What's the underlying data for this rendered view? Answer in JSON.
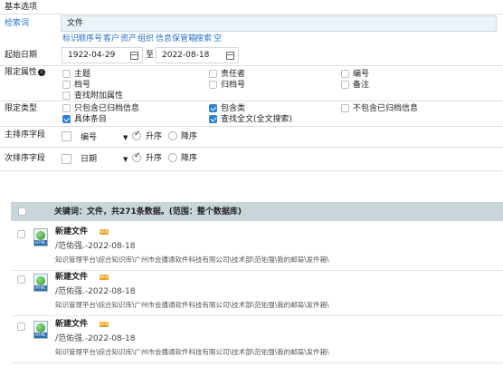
{
  "section_title": "基本选项",
  "keyword": {
    "label": "检索词",
    "value": "文件"
  },
  "quick_links": [
    "标识",
    "顺序号",
    "客户",
    "资产",
    "组织",
    "信息保管箱",
    "搜索",
    "空"
  ],
  "date": {
    "label": "起始日期",
    "from": "1922-04-29",
    "sep": "至",
    "to": "2022-08-18"
  },
  "attr": {
    "label": "限定属性",
    "options": [
      {
        "label": "主题",
        "checked": false
      },
      {
        "label": "责任者",
        "checked": false
      },
      {
        "label": "编号",
        "checked": false
      },
      {
        "label": "档号",
        "checked": false
      },
      {
        "label": "归档号",
        "checked": false
      },
      {
        "label": "备注",
        "checked": false
      },
      {
        "label": "查找附加属性",
        "checked": false
      }
    ]
  },
  "type": {
    "label": "限定类型",
    "options": [
      {
        "label": "只包含已归档信息",
        "checked": false
      },
      {
        "label": "包含类",
        "checked": true
      },
      {
        "label": "不包含已归档信息",
        "checked": false
      },
      {
        "label": "具体条目",
        "checked": true
      },
      {
        "label": "查找全文(全文搜索)",
        "checked": true
      }
    ]
  },
  "sort1": {
    "label": "主排序字段",
    "field": "编号",
    "asc": "升序",
    "desc": "降序"
  },
  "sort2": {
    "label": "次排序字段",
    "field": "日期",
    "asc": "升序",
    "desc": "降序"
  },
  "results_header": "关键词：文件，共271条数据。(范围：整个数据库)",
  "results": [
    {
      "title": "新建文件",
      "badge": "NEW",
      "meta": "/范佑强.-2022-08-18",
      "path": "知识管理平台\\综合知识库\\广州市会播通软件科技有限公司\\技术部\\范佑强\\我的邮局\\发件箱\\"
    },
    {
      "title": "新建文件",
      "badge": "NEW",
      "meta": "/范佑强.-2022-08-18",
      "path": "知识管理平台\\综合知识库\\广州市会播通软件科技有限公司\\技术部\\范佑强\\我的邮局\\发件箱\\"
    },
    {
      "title": "新建文件",
      "badge": "NEW",
      "meta": "/范佑强.-2022-08-18",
      "path": "知识管理平台\\综合知识库\\广州市会播通软件科技有限公司\\技术部\\范佑强\\我的邮局\\发件箱\\"
    }
  ],
  "file_icon_text": "HTML",
  "colors": {
    "link": "#2a74c9",
    "header_bg": "#c9d5d8",
    "check_on": "#2f7fd1",
    "badge": "#f0a020"
  }
}
